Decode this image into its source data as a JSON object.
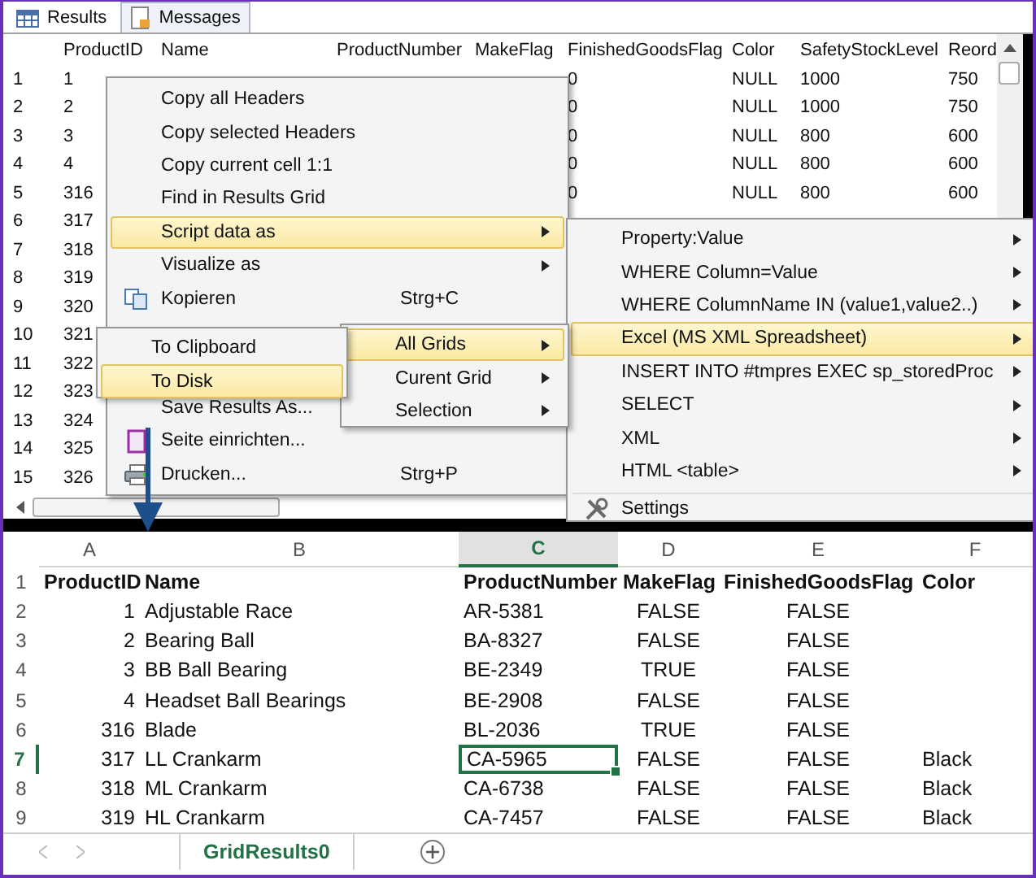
{
  "results_pane": {
    "tabs": [
      {
        "label": "Results",
        "selected": true
      },
      {
        "label": "Messages",
        "selected": false
      }
    ],
    "columns": [
      "ProductID",
      "Name",
      "ProductNumber",
      "MakeFlag",
      "FinishedGoodsFlag",
      "Color",
      "SafetyStockLevel",
      "Reord"
    ],
    "rows": [
      {
        "number": "1",
        "cells": [
          "1",
          null,
          null,
          null,
          "0",
          "NULL",
          "1000",
          "750"
        ]
      },
      {
        "number": "2",
        "cells": [
          "2",
          null,
          null,
          null,
          "0",
          "NULL",
          "1000",
          "750"
        ]
      },
      {
        "number": "3",
        "cells": [
          "3",
          null,
          null,
          null,
          "0",
          "NULL",
          "800",
          "600"
        ]
      },
      {
        "number": "4",
        "cells": [
          "4",
          null,
          null,
          null,
          "0",
          "NULL",
          "800",
          "600"
        ]
      },
      {
        "number": "5",
        "cells": [
          "316",
          null,
          null,
          null,
          "0",
          "NULL",
          "800",
          "600"
        ]
      },
      {
        "number": "6",
        "cells": [
          "317"
        ]
      },
      {
        "number": "7",
        "cells": [
          "318"
        ]
      },
      {
        "number": "8",
        "cells": [
          "319"
        ]
      },
      {
        "number": "9",
        "cells": [
          "320"
        ]
      },
      {
        "number": "10",
        "cells": [
          "321"
        ]
      },
      {
        "number": "11",
        "cells": [
          "322"
        ]
      },
      {
        "number": "12",
        "cells": [
          "323"
        ]
      },
      {
        "number": "13",
        "cells": [
          "324"
        ]
      },
      {
        "number": "14",
        "cells": [
          "325"
        ]
      },
      {
        "number": "15",
        "cells": [
          "326"
        ]
      }
    ]
  },
  "context_menu": {
    "groups": [
      [
        {
          "label": "Copy all Headers",
          "submenu": false,
          "selected": false
        },
        {
          "label": "Copy selected Headers",
          "submenu": false,
          "selected": false
        },
        {
          "label": "Copy current cell 1:1",
          "submenu": false,
          "selected": false
        },
        {
          "label": "Find in Results Grid",
          "submenu": false,
          "selected": false
        },
        {
          "label": "Script data as",
          "submenu": true,
          "selected": true
        },
        {
          "label": "Visualize as",
          "submenu": true,
          "selected": false
        },
        {
          "label": "Kopieren",
          "shortcut": "Strg+C",
          "kind": "icon_item",
          "submenu": false,
          "selected": false
        }
      ],
      [
        {
          "label": "Save Results As...",
          "submenu": false,
          "selected": false
        },
        {
          "label": "Seite einrichten...",
          "kind": "icon_item",
          "submenu": false,
          "selected": false
        },
        {
          "label": "Drucken...",
          "shortcut": "Strg+P",
          "kind": "icon_item",
          "submenu": false,
          "selected": false
        }
      ]
    ]
  },
  "script_submenu": {
    "items": [
      {
        "label": "Property:Value",
        "submenu": true,
        "selected": false
      },
      {
        "label": "WHERE Column=Value",
        "submenu": true,
        "selected": false
      },
      {
        "label": "WHERE ColumnName IN (value1,value2..)",
        "submenu": true,
        "selected": false
      },
      {
        "label": "Excel (MS XML Spreadsheet)",
        "submenu": true,
        "selected": true
      },
      {
        "label": "INSERT INTO #tmpres EXEC sp_storedProc",
        "submenu": true,
        "selected": false
      },
      {
        "label": "SELECT",
        "submenu": true,
        "selected": false
      },
      {
        "label": "XML",
        "submenu": true,
        "selected": false
      },
      {
        "label": "HTML <table>",
        "submenu": true,
        "selected": false
      },
      {
        "label": "Settings",
        "kind": "icon_item",
        "submenu": false,
        "selected": false
      }
    ]
  },
  "grids_submenu": {
    "items": [
      {
        "label": "All Grids",
        "submenu": true,
        "selected": true
      },
      {
        "label": "Curent Grid",
        "submenu": true,
        "selected": false
      },
      {
        "label": "Selection",
        "submenu": true,
        "selected": false
      }
    ]
  },
  "destination_submenu": {
    "items": [
      {
        "label": "To Clipboard",
        "submenu": false,
        "selected": false
      },
      {
        "label": "To Disk",
        "submenu": false,
        "selected": true
      }
    ]
  },
  "spreadsheet": {
    "columns": [
      {
        "letter": "A",
        "kind": "number",
        "selected": false
      },
      {
        "letter": "B",
        "kind": "text",
        "selected": false
      },
      {
        "letter": "C",
        "kind": "text",
        "selected": true
      },
      {
        "letter": "D",
        "kind": "boolean",
        "selected": false
      },
      {
        "letter": "E",
        "kind": "boolean",
        "selected": false
      },
      {
        "letter": "F",
        "kind": "text",
        "selected": false
      }
    ],
    "rows": [
      {
        "number": "1",
        "kind": "header",
        "selected": false,
        "cells": [
          "ProductID",
          "Name",
          "ProductNumber",
          "MakeFlag",
          "FinishedGoodsFlag",
          "Color"
        ]
      },
      {
        "number": "2",
        "kind": "data",
        "selected": false,
        "cells": [
          "1",
          "Adjustable Race",
          "AR-5381",
          "FALSE",
          "FALSE"
        ]
      },
      {
        "number": "3",
        "kind": "data",
        "selected": false,
        "cells": [
          "2",
          "Bearing Ball",
          "BA-8327",
          "FALSE",
          "FALSE"
        ]
      },
      {
        "number": "4",
        "kind": "data",
        "selected": false,
        "cells": [
          "3",
          "BB Ball Bearing",
          "BE-2349",
          "TRUE",
          "FALSE"
        ]
      },
      {
        "number": "5",
        "kind": "data",
        "selected": false,
        "cells": [
          "4",
          "Headset Ball Bearings",
          "BE-2908",
          "FALSE",
          "FALSE"
        ]
      },
      {
        "number": "6",
        "kind": "data",
        "selected": false,
        "cells": [
          "316",
          "Blade",
          "BL-2036",
          "TRUE",
          "FALSE"
        ]
      },
      {
        "number": "7",
        "kind": "data",
        "selected": true,
        "cells": [
          "317",
          "LL Crankarm",
          "CA-5965",
          "FALSE",
          "FALSE",
          "Black"
        ]
      },
      {
        "number": "8",
        "kind": "data",
        "selected": false,
        "cells": [
          "318",
          "ML Crankarm",
          "CA-6738",
          "FALSE",
          "FALSE",
          "Black"
        ]
      },
      {
        "number": "9",
        "kind": "data",
        "selected": false,
        "cells": [
          "319",
          "HL Crankarm",
          "CA-7457",
          "FALSE",
          "FALSE",
          "Black"
        ]
      }
    ],
    "sheet_tabs": [
      {
        "label": "GridResults0",
        "selected": true
      }
    ]
  }
}
